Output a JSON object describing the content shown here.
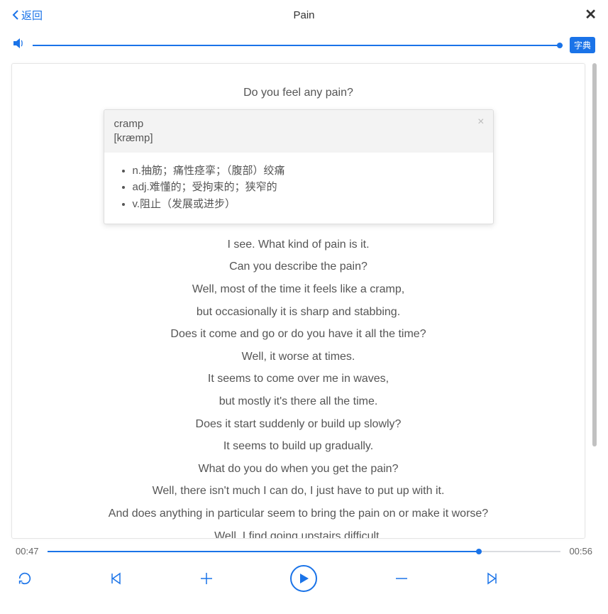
{
  "header": {
    "back_label": "返回",
    "title": "Pain"
  },
  "audio": {
    "dict_label": "字典"
  },
  "popover": {
    "word": "cramp",
    "phonetic": "[kræmp]",
    "definitions": [
      "n.抽筋；痛性痉挛；（腹部）绞痛",
      "adj.难懂的；受拘束的；狭窄的",
      "v.阻止（发展或进步）"
    ]
  },
  "lines": [
    "Do you feel any pain?",
    "I see. What kind of pain is it.",
    "Can you describe the pain?",
    "Well, most of the time it feels like a cramp,",
    "but occasionally it is sharp and stabbing.",
    "Does it come and go or do you have it all the time?",
    "Well, it worse at times.",
    "It seems to come over me in waves,",
    "but mostly it's there all the time.",
    "Does it start suddenly or build up slowly?",
    "It seems to build up gradually.",
    "What do you do when you get the pain?",
    "Well, there isn't much I can do, I just have to put up with it.",
    "And does anything in particular seem to bring the pain on or make it worse?",
    "Well, I find going upstairs difficult."
  ],
  "progress": {
    "current": "00:47",
    "total": "00:56"
  }
}
